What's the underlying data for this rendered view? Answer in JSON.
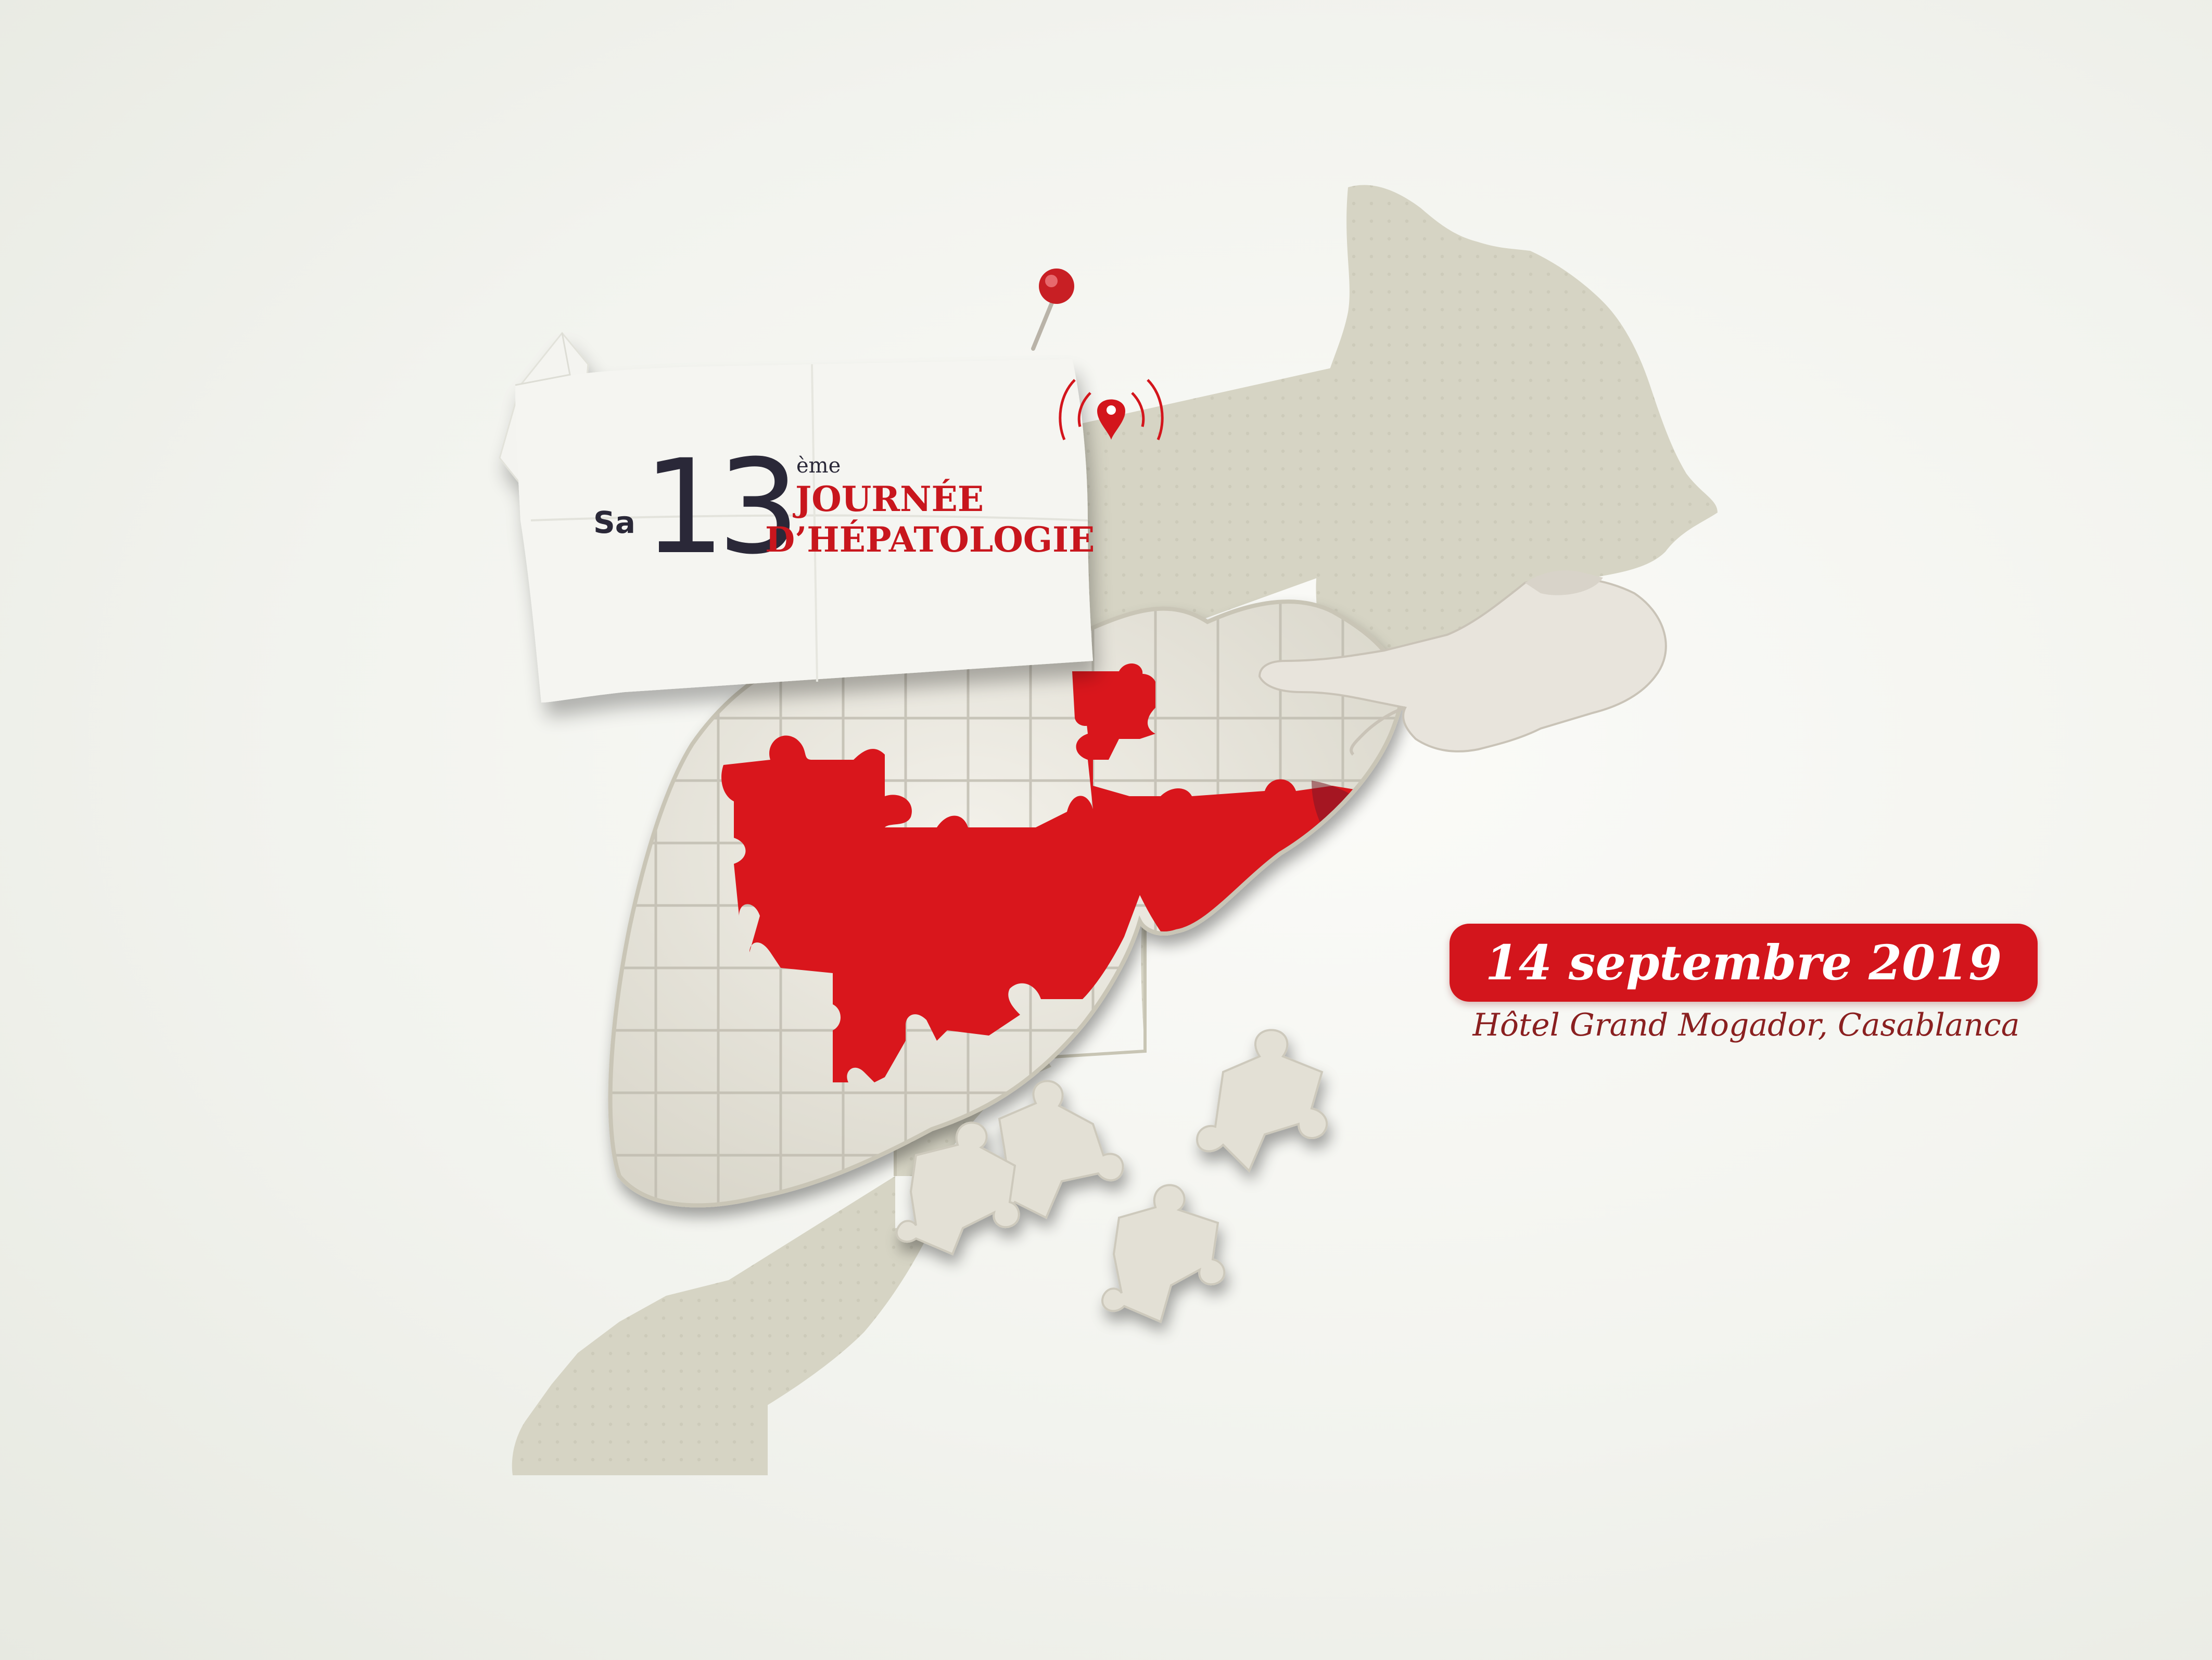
{
  "event": {
    "prefix": "Sa",
    "number": "13",
    "ordinal_suffix": "ème",
    "title_line1": "JOURNÉE",
    "title_line2": "D’HÉPATOLOGIE"
  },
  "date": "14 septembre 2019",
  "venue": "Hôtel Grand Mogador, Casablanca",
  "icons": [
    "push-pin-icon",
    "location-pin-icon"
  ],
  "colors": {
    "accent_red": "#d3151c",
    "dark_text": "#2a2838",
    "map_beige": "#d6d4c4",
    "puzzle_beige": "#e6e3d8",
    "background": "#f2f3ee"
  }
}
